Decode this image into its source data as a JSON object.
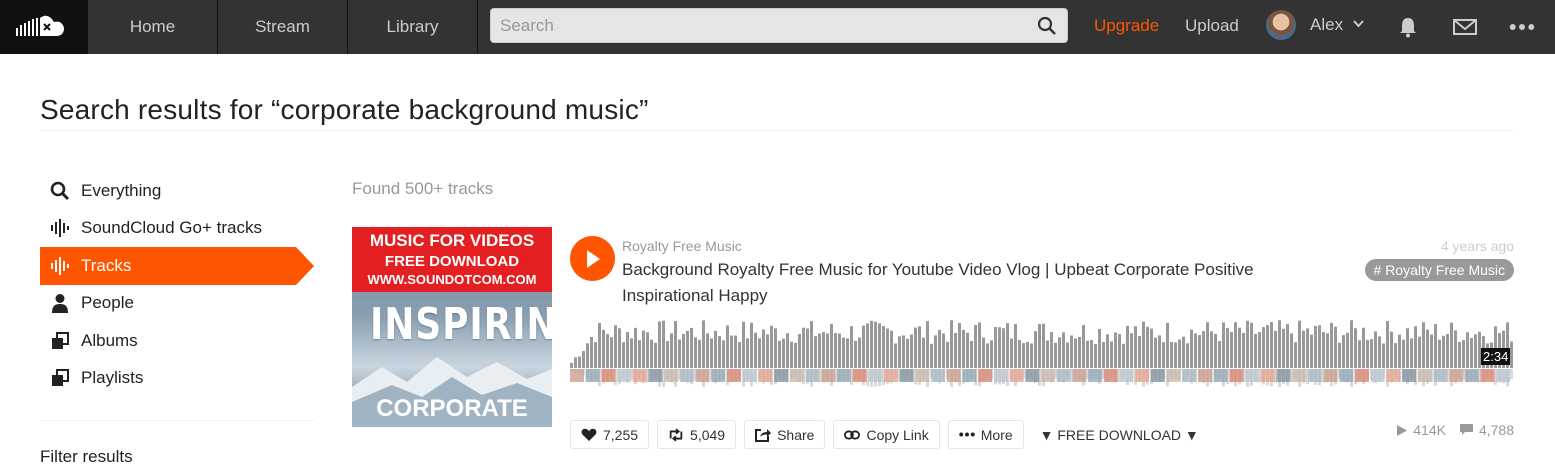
{
  "header": {
    "nav": {
      "home": "Home",
      "stream": "Stream",
      "library": "Library"
    },
    "search": {
      "placeholder": "Search"
    },
    "upgrade": "Upgrade",
    "upload": "Upload",
    "user": {
      "name": "Alex"
    }
  },
  "page": {
    "title": "Search results for “corporate background music”"
  },
  "sidebar": {
    "items": [
      {
        "label": "Everything",
        "icon": "search-icon"
      },
      {
        "label": "SoundCloud Go+ tracks",
        "icon": "waveform-icon"
      },
      {
        "label": "Tracks",
        "icon": "waveform-icon",
        "active": true
      },
      {
        "label": "People",
        "icon": "person-icon"
      },
      {
        "label": "Albums",
        "icon": "stack-icon"
      },
      {
        "label": "Playlists",
        "icon": "stack-icon"
      }
    ],
    "filter_title": "Filter results"
  },
  "results": {
    "found": "Found 500+ tracks",
    "tracks": [
      {
        "artwork": {
          "line1": "MUSIC FOR VIDEOS",
          "line2": "FREE DOWNLOAD",
          "line3": "WWW.SOUNDOTCOM.COM",
          "big": "INSPIRING",
          "bottom": "CORPORATE"
        },
        "uploader": "Royalty Free Music",
        "title": "Background Royalty Free Music for Youtube Video Vlog | Upbeat Corporate Positive Inspirational Happy",
        "timestamp": "4 years ago",
        "tag": "# Royalty Free Music",
        "duration": "2:34",
        "actions": {
          "likes": "7,255",
          "reposts": "5,049",
          "share": "Share",
          "copy_link": "Copy Link",
          "more": "More",
          "free_download": "▼ FREE DOWNLOAD ▼"
        },
        "plays": "414K",
        "comments": "4,788"
      }
    ]
  },
  "colors": {
    "accent": "#ff5500",
    "header_bg": "#333333"
  }
}
